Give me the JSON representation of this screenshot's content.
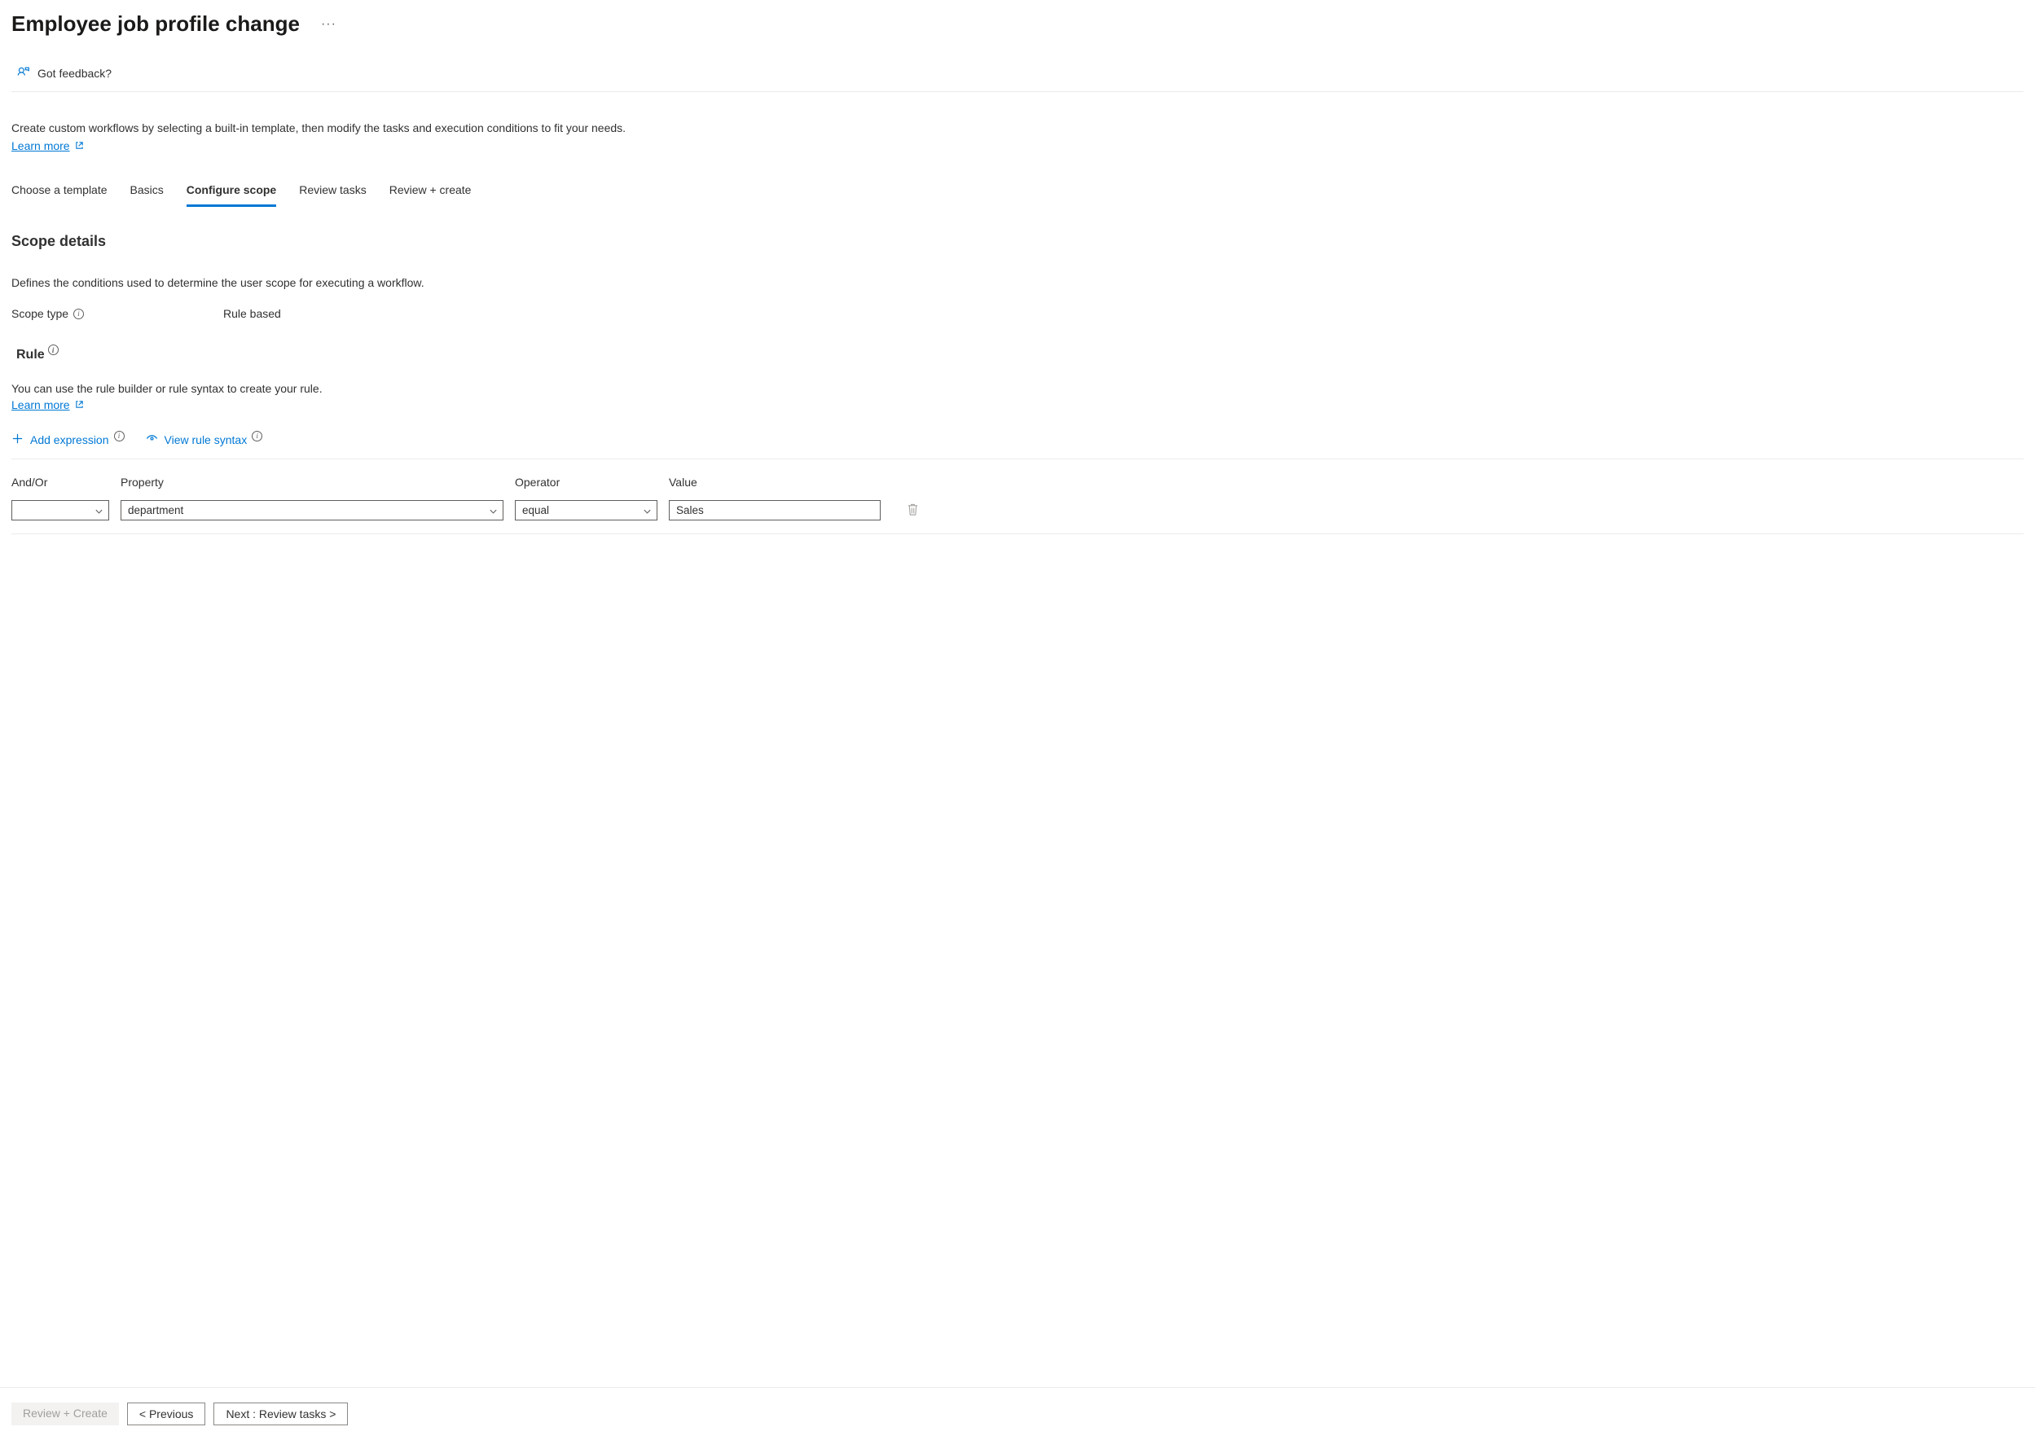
{
  "header": {
    "title": "Employee job profile change",
    "feedback_label": "Got feedback?"
  },
  "intro": {
    "text": "Create custom workflows by selecting a built-in template, then modify the tasks and execution conditions to fit your needs.",
    "learn_more": "Learn more"
  },
  "tabs": {
    "choose_template": "Choose a template",
    "basics": "Basics",
    "configure_scope": "Configure scope",
    "review_tasks": "Review tasks",
    "review_create": "Review + create"
  },
  "scope": {
    "heading": "Scope details",
    "description": "Defines the conditions used to determine the user scope for executing a workflow.",
    "type_label": "Scope type",
    "type_value": "Rule based"
  },
  "rule": {
    "heading": "Rule",
    "description": "You can use the rule builder or rule syntax to create your rule.",
    "learn_more": "Learn more",
    "add_expression": "Add expression",
    "view_syntax": "View rule syntax",
    "columns": {
      "and_or": "And/Or",
      "property": "Property",
      "operator": "Operator",
      "value": "Value"
    },
    "row": {
      "and_or": "",
      "property": "department",
      "operator": "equal",
      "value": "Sales"
    }
  },
  "footer": {
    "review_create": "Review + Create",
    "previous": "< Previous",
    "next": "Next : Review tasks >"
  }
}
